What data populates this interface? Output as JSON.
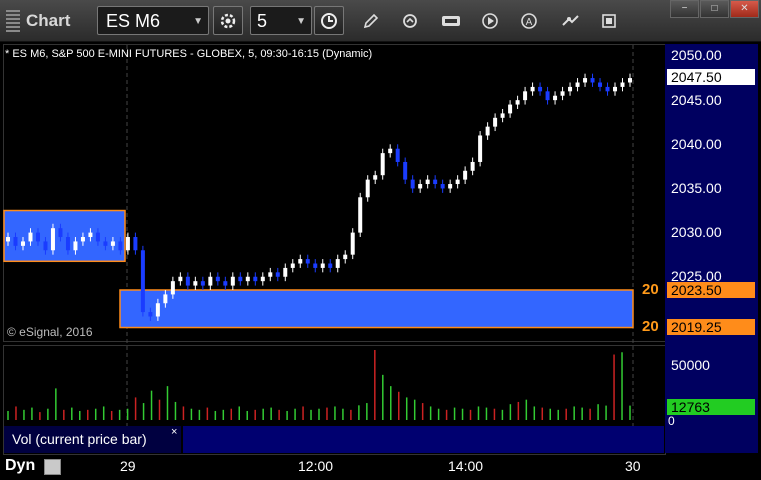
{
  "toolbar": {
    "title": "Chart",
    "symbol": "ES M6",
    "interval": "5",
    "icons": [
      "settings-cog-icon",
      "clock-icon",
      "pencil-icon",
      "refresh-icon",
      "data-icon",
      "play-icon",
      "alert-icon",
      "link-icon",
      "page-icon"
    ]
  },
  "chart": {
    "header": "* ES M6, S&P 500 E-MINI FUTURES - GLOBEX, 5, 09:30-16:15 (Dynamic)",
    "copyright": "© eSignal, 2016",
    "price_labels": [
      "2050.00",
      "2045.00",
      "2040.00",
      "2035.00",
      "2030.00",
      "2025.00"
    ],
    "last_price": "2047.50",
    "level_upper": "2023.50",
    "level_lower": "2019.25",
    "level_upper_count": "20",
    "level_lower_count": "20",
    "volume_label": "50000",
    "volume_zero": "0",
    "volume_current": "12763",
    "volume_study": "Vol (current price bar)",
    "volume_close": "×",
    "time_labels": [
      "29",
      "12:00",
      "14:00",
      "30"
    ],
    "footer_mode": "Dyn",
    "colors": {
      "up": "#ffffff",
      "down": "#1a3cff",
      "zone": "#3366ff",
      "zone_border": "#ff8c1a",
      "last_price_tag": "#ffffff",
      "level_tag": "#ff8c1a",
      "volume_tag": "#22cc22"
    }
  },
  "chart_data": {
    "type": "bar",
    "title": "ES M6, S&P 500 E-MINI FUTURES - GLOBEX, 5, 09:30-16:15 (Dynamic)",
    "ylim": [
      2018,
      2052
    ],
    "price_closes": [
      2029.5,
      2028.5,
      2029,
      2030,
      2029,
      2028,
      2030.5,
      2029.5,
      2028,
      2029,
      2029.5,
      2030,
      2029,
      2028.5,
      2029,
      2028,
      2029.5,
      2028,
      2021,
      2020.5,
      2022,
      2023,
      2024.5,
      2025,
      2024,
      2024.5,
      2024,
      2025,
      2024.5,
      2024,
      2025,
      2024.5,
      2025,
      2024.5,
      2025,
      2025.5,
      2025,
      2026,
      2026.5,
      2027,
      2026.5,
      2026,
      2026.5,
      2026,
      2027,
      2027.5,
      2030,
      2034,
      2036,
      2036.5,
      2039,
      2039.5,
      2038,
      2036,
      2035,
      2035.5,
      2036,
      2035.5,
      2035,
      2035.5,
      2036,
      2037,
      2038,
      2041,
      2042,
      2043,
      2043.5,
      2044.5,
      2045,
      2046,
      2046.5,
      2046,
      2045,
      2045.5,
      2046,
      2046.5,
      2047,
      2047.5,
      2047,
      2046.5,
      2046,
      2046.5,
      2047,
      2047.5
    ],
    "volume": [
      8000,
      12000,
      9000,
      11000,
      7000,
      10000,
      28000,
      9000,
      11000,
      8000,
      9000,
      10000,
      12000,
      8000,
      9000,
      10000,
      20000,
      15000,
      26000,
      18000,
      30000,
      16000,
      12000,
      10000,
      9000,
      11000,
      8000,
      9000,
      10000,
      12000,
      8000,
      9000,
      10000,
      11000,
      9000,
      8000,
      10000,
      12000,
      9000,
      10000,
      11000,
      12000,
      10000,
      9000,
      13000,
      15000,
      62000,
      40000,
      30000,
      25000,
      20000,
      18000,
      15000,
      12000,
      10000,
      9000,
      11000,
      10000,
      9000,
      12000,
      11000,
      10000,
      9000,
      14000,
      16000,
      18000,
      12000,
      11000,
      10000,
      9000,
      10000,
      12000,
      11000,
      10000,
      14000,
      12763,
      58000,
      60000,
      12763
    ]
  }
}
